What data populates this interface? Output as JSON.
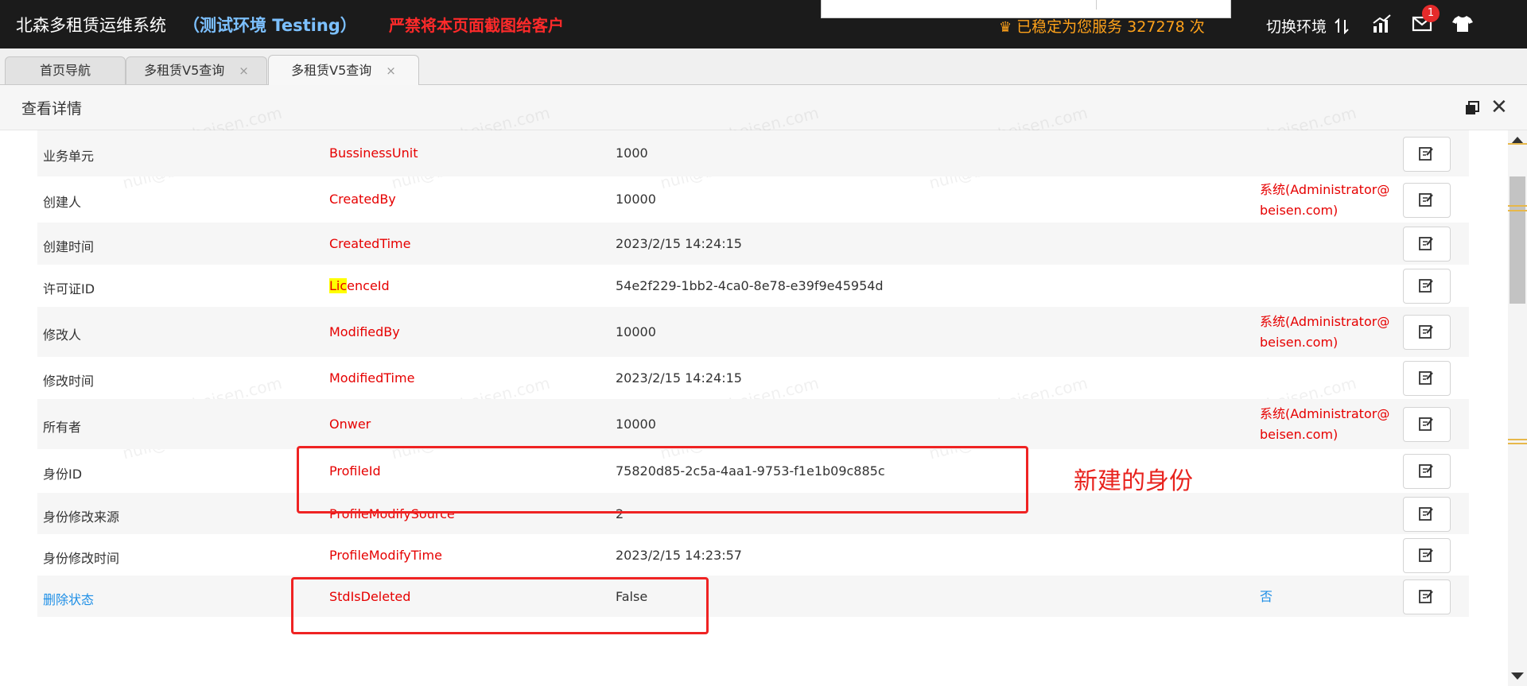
{
  "header": {
    "app_title": "北森多租赁运维系统",
    "env_tag": "（测试环境 Testing）",
    "warning": "严禁将本页面截图给客户",
    "service_text": "已稳定为您服务 327278 次",
    "switch_env": "切换环境",
    "mail_badge": "1",
    "icons": [
      "crown-icon",
      "switch-env-icon",
      "chart-icon",
      "mail-icon",
      "shirt-icon"
    ],
    "colors": {
      "env_tag": "#7cc0ff",
      "warning": "#ff2a2a",
      "service": "#ffa21a"
    }
  },
  "tabs": [
    {
      "label": "首页导航"
    },
    {
      "label": "多租赁V5查询",
      "close": "×"
    },
    {
      "label": "多租赁V5查询",
      "close": "×"
    }
  ],
  "panel": {
    "title": "查看详情"
  },
  "rows": [
    {
      "label": "业务单元",
      "field": "BussinessUnit",
      "value": "1000",
      "display": ""
    },
    {
      "label": "创建人",
      "field": "CreatedBy",
      "value": "10000",
      "display": "系统(Administrator@beisen.com)"
    },
    {
      "label": "创建时间",
      "field": "CreatedTime",
      "value": "2023/2/15 14:24:15",
      "display": ""
    },
    {
      "label": "许可证ID",
      "field_highlight": "Lic",
      "field_rest": "enceId",
      "value": "54e2f229-1bb2-4ca0-8e78-e39f9e45954d",
      "display": ""
    },
    {
      "label": "修改人",
      "field": "ModifiedBy",
      "value": "10000",
      "display": "系统(Administrator@beisen.com)"
    },
    {
      "label": "修改时间",
      "field": "ModifiedTime",
      "value": "2023/2/15 14:24:15",
      "display": ""
    },
    {
      "label": "所有者",
      "field": "Onwer",
      "value": "10000",
      "display": "系统(Administrator@beisen.com)"
    },
    {
      "label": "身份ID",
      "field": "ProfileId",
      "value": "75820d85-2c5a-4aa1-9753-f1e1b09c885c",
      "display": ""
    },
    {
      "label": "身份修改来源",
      "field": "ProfileModifySource",
      "value": "2",
      "display": ""
    },
    {
      "label": "身份修改时间",
      "field": "ProfileModifyTime",
      "value": "2023/2/15 14:23:57",
      "display": ""
    },
    {
      "label": "删除状态",
      "field": "StdIsDeleted",
      "value": "False",
      "display": "否"
    }
  ],
  "annotation": {
    "text": "新建的身份",
    "color": "#e8231e"
  },
  "watermark": "null@beisen.com"
}
